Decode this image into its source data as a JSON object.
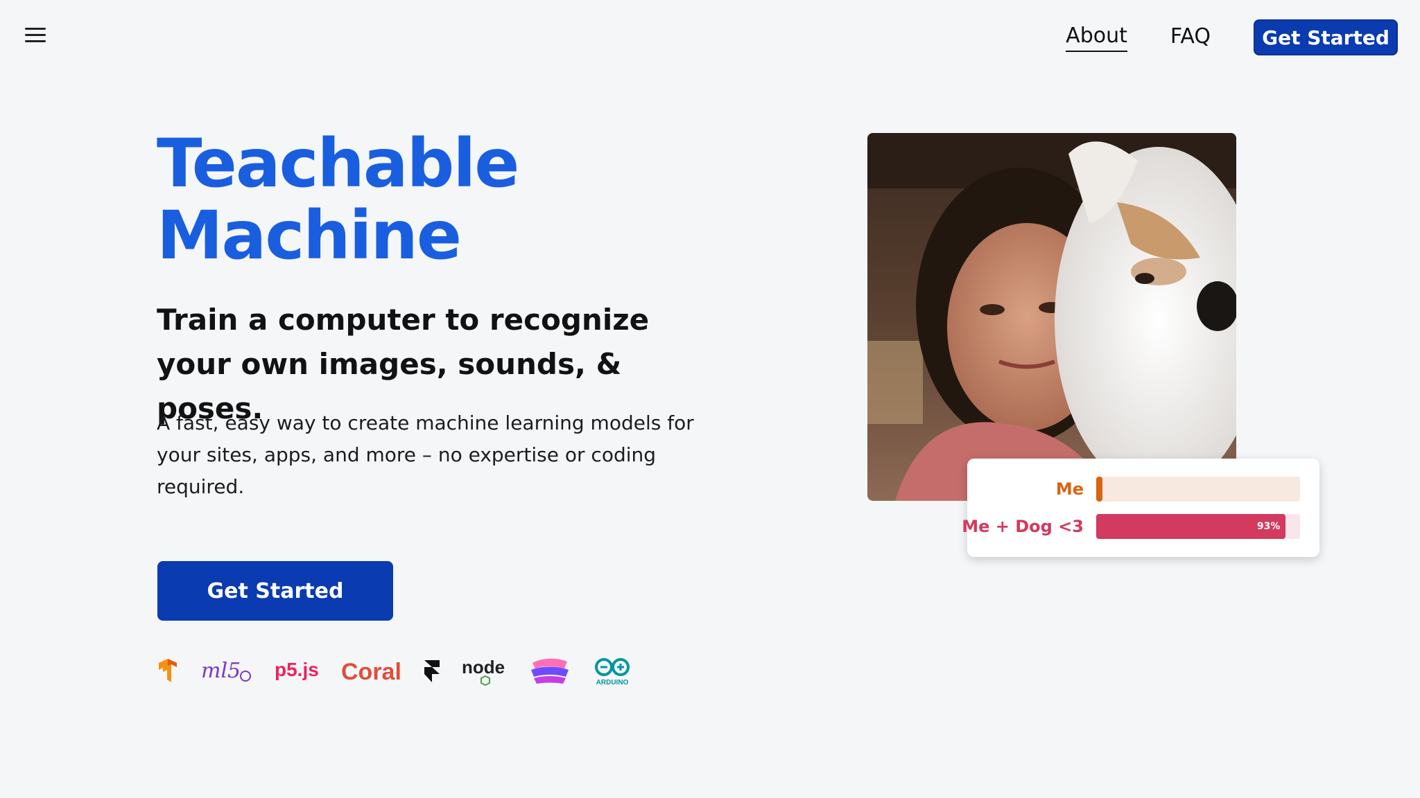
{
  "nav": {
    "menu_icon": "hamburger-menu-icon",
    "links": [
      {
        "label": "About",
        "active": true
      },
      {
        "label": "FAQ",
        "active": false
      }
    ],
    "cta_label": "Get Started"
  },
  "hero": {
    "title_line1": "Teachable",
    "title_line2": "Machine",
    "subtitle": "Train a computer to recognize your own images, sounds, & poses.",
    "description": "A fast, easy way to create machine learning models for your sites, apps, and more – no expertise or coding required.",
    "cta_label": "Get Started"
  },
  "logos": [
    {
      "name": "tensorflow-logo-icon"
    },
    {
      "name": "ml5-logo-icon",
      "text": "ml5"
    },
    {
      "name": "p5js-logo-icon",
      "text": "p5.js"
    },
    {
      "name": "coral-logo-icon",
      "text": "Coral"
    },
    {
      "name": "framer-logo-icon"
    },
    {
      "name": "nodejs-logo-icon",
      "text": "node"
    },
    {
      "name": "glitch-logo-icon"
    },
    {
      "name": "arduino-logo-icon",
      "text": "ARDUINO"
    }
  ],
  "prediction": {
    "rows": [
      {
        "label": "Me",
        "value": 0.03,
        "percent_text": "",
        "color": "#d9640f",
        "track": "#f7e9df"
      },
      {
        "label": "Me + Dog <3",
        "value": 0.93,
        "percent_text": "93%",
        "color": "#d23a5f",
        "track": "#fae6ea"
      }
    ]
  },
  "colors": {
    "brand_blue": "#1a5ee0",
    "button_blue": "#0b3bb1",
    "background": "#f4f6f8"
  }
}
